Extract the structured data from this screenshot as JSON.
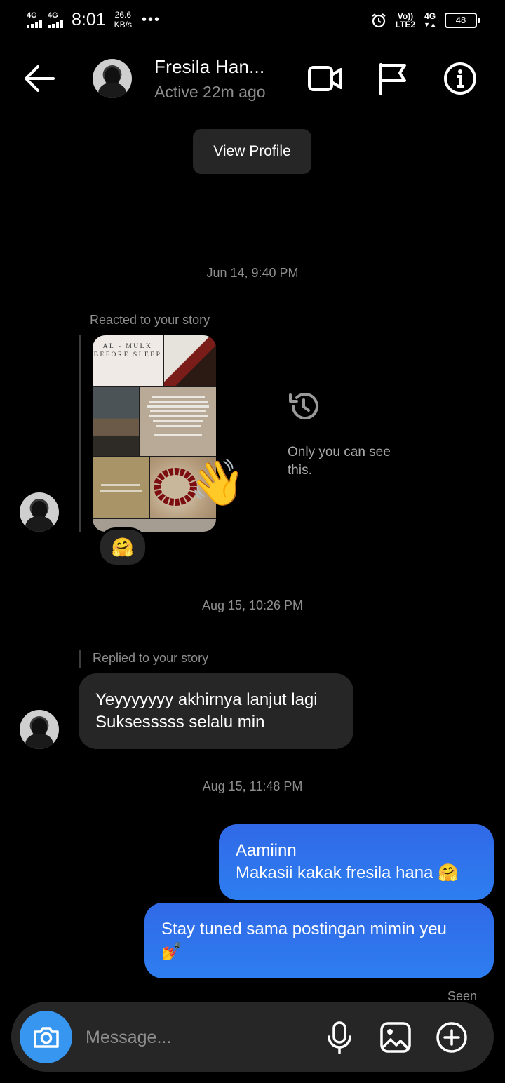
{
  "status_bar": {
    "sim1": "4G",
    "sim2": "4G",
    "time": "8:01",
    "speed_value": "26.6",
    "speed_unit": "KB/s",
    "more": "•••",
    "volte": "Vo))",
    "lte2": "LTE2",
    "net": "4G",
    "battery": "48"
  },
  "header": {
    "name": "Fresila Han...",
    "active": "Active 22m ago",
    "view_profile": "View Profile"
  },
  "thread": {
    "ts1": "Jun 14, 9:40 PM",
    "story_reaction_label": "Reacted to your story",
    "story_text": {
      "title": "AL - MULK BEFORE SLEEP"
    },
    "story_reaction_emoji": "👋",
    "reaction_chip": "🤗",
    "private_note": "Only you can see this.",
    "ts2": "Aug 15, 10:26 PM",
    "story_reply_label": "Replied to your story",
    "incoming_message": [
      "Yeyyyyyyy akhirnya lanjut lagi",
      "Suksesssss selalu min"
    ],
    "ts3": "Aug 15, 11:48 PM",
    "outgoing_1": [
      "Aamiinn",
      "Makasii kakak fresila hana 🤗"
    ],
    "outgoing_2": [
      "Stay tuned sama postingan mimin yeu",
      "💅"
    ],
    "seen": "Seen"
  },
  "composer": {
    "placeholder": "Message..."
  },
  "colors": {
    "background": "#000000",
    "bubble_incoming": "#262626",
    "bubble_outgoing": "#3169e7",
    "camera_button": "#3797f0",
    "muted_text": "#8e8e8e"
  },
  "icons": [
    "back-arrow-icon",
    "video-call-icon",
    "flag-icon",
    "info-icon",
    "history-icon",
    "camera-icon",
    "microphone-icon",
    "gallery-icon",
    "plus-circle-icon"
  ]
}
